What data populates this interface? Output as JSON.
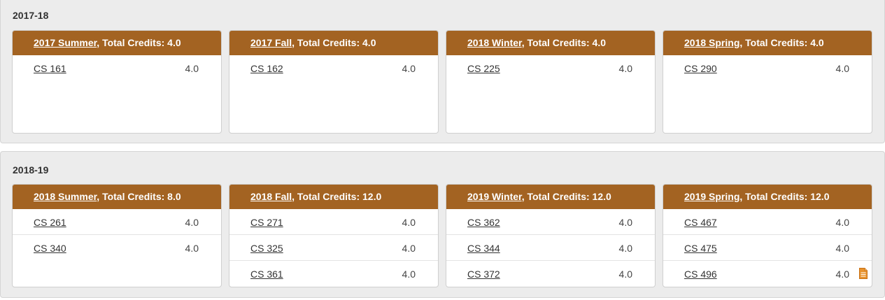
{
  "years": [
    {
      "label": "2017-18",
      "terms": [
        {
          "name": "2017 Summer",
          "credits_text": ", Total Credits: 4.0",
          "courses": [
            {
              "code": "CS 161",
              "credits": "4.0"
            }
          ]
        },
        {
          "name": "2017 Fall",
          "credits_text": ", Total Credits: 4.0",
          "courses": [
            {
              "code": "CS 162",
              "credits": "4.0"
            }
          ]
        },
        {
          "name": "2018 Winter",
          "credits_text": ", Total Credits: 4.0",
          "courses": [
            {
              "code": "CS 225",
              "credits": "4.0"
            }
          ]
        },
        {
          "name": "2018 Spring",
          "credits_text": ", Total Credits: 4.0",
          "courses": [
            {
              "code": "CS 290",
              "credits": "4.0"
            }
          ]
        }
      ]
    },
    {
      "label": "2018-19",
      "terms": [
        {
          "name": "2018 Summer",
          "credits_text": ", Total Credits: 8.0",
          "courses": [
            {
              "code": "CS 261",
              "credits": "4.0"
            },
            {
              "code": "CS 340",
              "credits": "4.0"
            }
          ]
        },
        {
          "name": "2018 Fall",
          "credits_text": ", Total Credits: 12.0",
          "courses": [
            {
              "code": "CS 271",
              "credits": "4.0"
            },
            {
              "code": "CS 325",
              "credits": "4.0"
            },
            {
              "code": "CS 361",
              "credits": "4.0"
            }
          ]
        },
        {
          "name": "2019 Winter",
          "credits_text": ", Total Credits: 12.0",
          "courses": [
            {
              "code": "CS 362",
              "credits": "4.0"
            },
            {
              "code": "CS 344",
              "credits": "4.0"
            },
            {
              "code": "CS 372",
              "credits": "4.0"
            }
          ]
        },
        {
          "name": "2019 Spring",
          "credits_text": ", Total Credits: 12.0",
          "courses": [
            {
              "code": "CS 467",
              "credits": "4.0"
            },
            {
              "code": "CS 475",
              "credits": "4.0"
            },
            {
              "code": "CS 496",
              "credits": "4.0",
              "note_icon": "document-icon"
            }
          ]
        }
      ]
    }
  ],
  "colors": {
    "header": "#a36322",
    "icon": "#e8932e"
  }
}
